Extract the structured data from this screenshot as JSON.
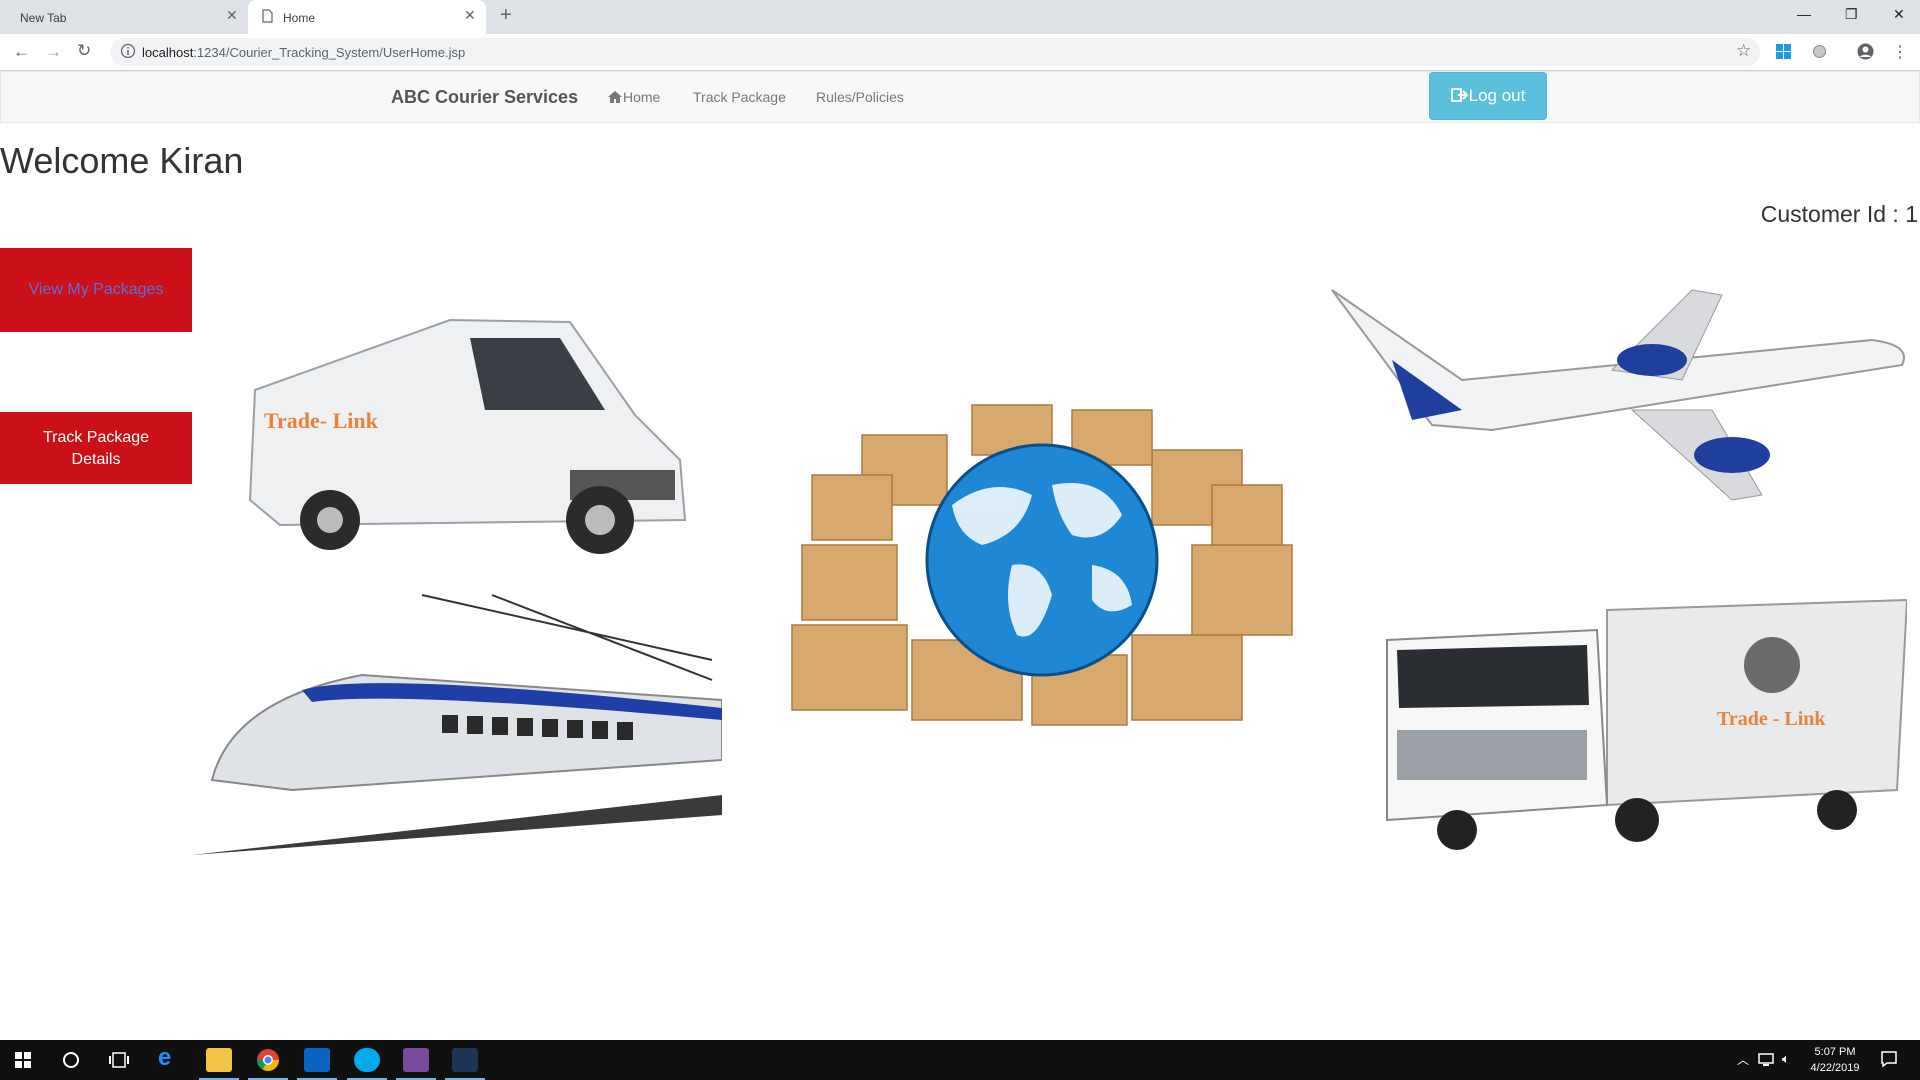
{
  "browser": {
    "tabs": [
      {
        "title": "New Tab"
      },
      {
        "title": "Home"
      }
    ],
    "url_host": "localhost",
    "url_path": ":1234/Courier_Tracking_System/UserHome.jsp"
  },
  "navbar": {
    "brand": "ABC Courier Services",
    "home": "Home",
    "track": "Track Package",
    "rules": "Rules/Policies",
    "logout": "Log out"
  },
  "page": {
    "welcome": "Welcome Kiran",
    "customer_id": "Customer Id : 1",
    "view_packages": "View My Packages",
    "track_details": "Track Package Details",
    "van_text": "Trade- Link",
    "truck_text": "Trade - Link"
  },
  "taskbar": {
    "time": "5:07 PM",
    "date": "4/22/2019"
  },
  "colors": {
    "accent_blue": "#5bc0de",
    "button_red": "#cc1018",
    "link_purple": "#5b6ed6",
    "trade_link_orange": "#e8833a"
  }
}
